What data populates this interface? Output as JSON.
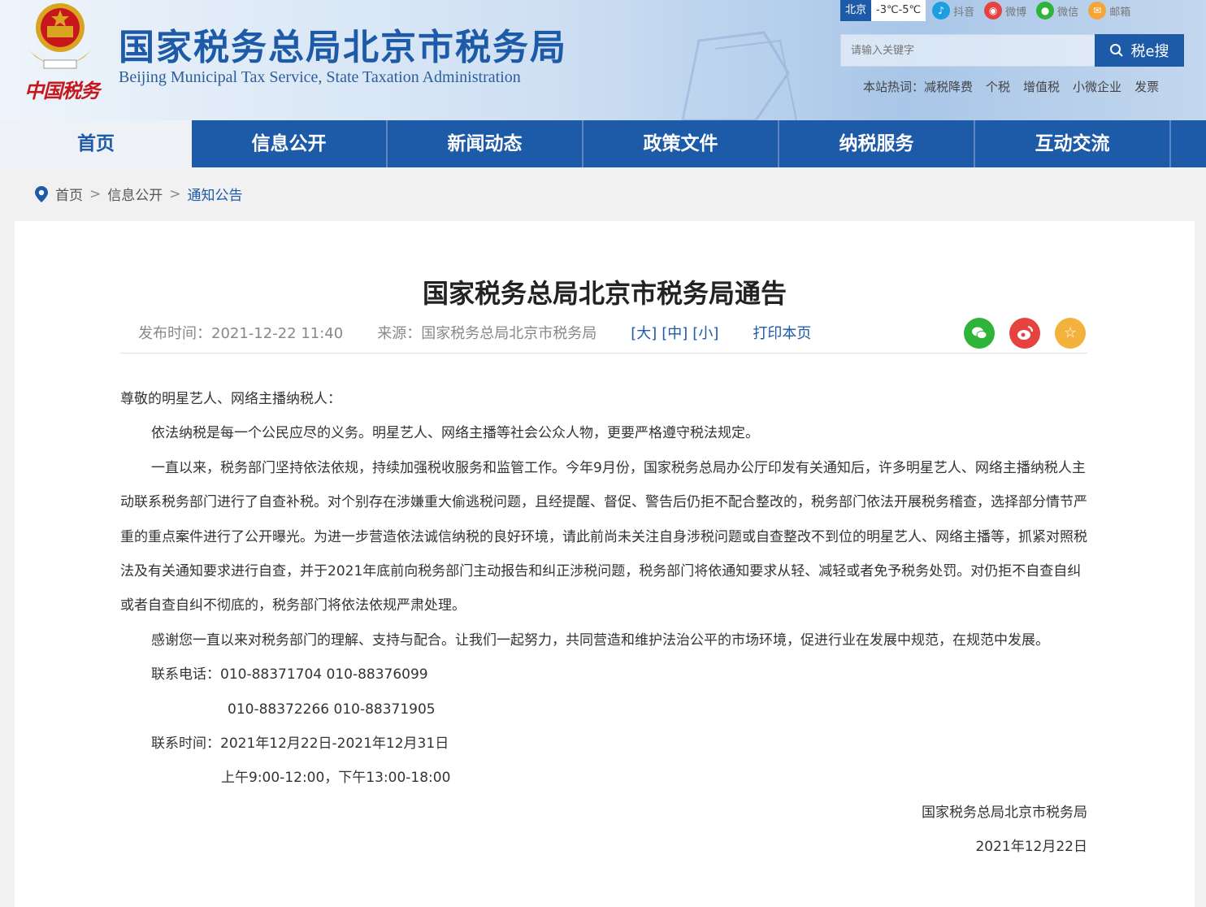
{
  "header": {
    "title": "国家税务总局北京市税务局",
    "subtitle": "Beijing Municipal Tax Service, State Taxation Administration",
    "emblem_caption": "中国税务",
    "city": "北京",
    "temperature": "-3℃-5℃",
    "social": [
      {
        "label": "抖音",
        "icon": "douyin-icon",
        "color": "#1b9fe0"
      },
      {
        "label": "微博",
        "icon": "weibo-icon",
        "color": "#e64340"
      },
      {
        "label": "微信",
        "icon": "wechat-icon",
        "color": "#2fb43a"
      },
      {
        "label": "邮箱",
        "icon": "mail-icon",
        "color": "#f3a536"
      }
    ],
    "search_placeholder": "请输入关键字",
    "search_button": "税e搜",
    "hot_words": [
      "本站热词：减税降费",
      "个税",
      "增值税",
      "小微企业",
      "发票"
    ]
  },
  "nav": [
    "首页",
    "信息公开",
    "新闻动态",
    "政策文件",
    "纳税服务",
    "互动交流"
  ],
  "breadcrumb": [
    "首页",
    "信息公开",
    "通知公告"
  ],
  "article": {
    "title": "国家税务总局北京市税务局通告",
    "publish_time": "发布时间：2021-12-22 11:40",
    "source": "来源：国家税务总局北京市税务局",
    "font_sizes": [
      "[大]",
      "[中]",
      "[小]"
    ],
    "print": "打印本页",
    "greeting": "尊敬的明星艺人、网络主播纳税人：",
    "paragraphs": [
      "依法纳税是每一个公民应尽的义务。明星艺人、网络主播等社会公众人物，更要严格遵守税法规定。",
      "一直以来，税务部门坚持依法依规，持续加强税收服务和监管工作。今年9月份，国家税务总局办公厅印发有关通知后，许多明星艺人、网络主播纳税人主动联系税务部门进行了自查补税。对个别存在涉嫌重大偷逃税问题，且经提醒、督促、警告后仍拒不配合整改的，税务部门依法开展税务稽查，选择部分情节严重的重点案件进行了公开曝光。为进一步营造依法诚信纳税的良好环境，请此前尚未关注自身涉税问题或自查整改不到位的明星艺人、网络主播等，抓紧对照税法及有关通知要求进行自查，并于2021年底前向税务部门主动报告和纠正涉税问题，税务部门将依通知要求从轻、减轻或者免予税务处罚。对仍拒不自查自纠或者自查自纠不彻底的，税务部门将依法依规严肃处理。",
      "感谢您一直以来对税务部门的理解、支持与配合。让我们一起努力，共同营造和维护法治公平的市场环境，促进行业在发展中规范，在规范中发展。"
    ],
    "phone_line1": "联系电话：010-88371704  010-88376099",
    "phone_line2": "010-88372266  010-88371905",
    "time_line1": "联系时间：2021年12月22日-2021年12月31日",
    "time_line2": "上午9:00-12:00，下午13:00-18:00",
    "signature": "国家税务总局北京市税务局",
    "date": "2021年12月22日"
  },
  "share": [
    {
      "icon": "wechat-share-icon",
      "color": "#2fb43a"
    },
    {
      "icon": "weibo-share-icon",
      "color": "#e64340"
    },
    {
      "icon": "favorite-star-icon",
      "color": "#f3b23c"
    }
  ]
}
